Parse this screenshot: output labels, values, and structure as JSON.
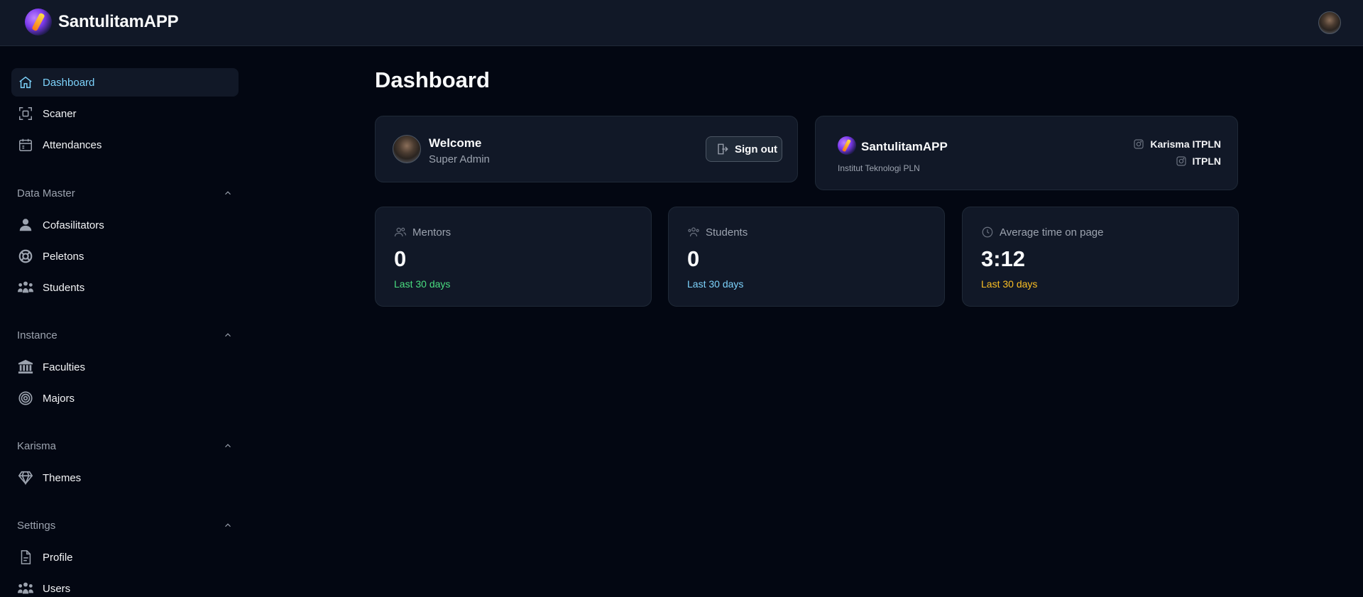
{
  "app": {
    "name": "SantulitamAPP"
  },
  "sidebar": {
    "top_items": [
      {
        "label": "Dashboard",
        "icon": "home-icon",
        "active": true
      },
      {
        "label": "Scaner",
        "icon": "scan-icon"
      },
      {
        "label": "Attendances",
        "icon": "calendar-icon"
      }
    ],
    "groups": [
      {
        "label": "Data Master",
        "items": [
          {
            "label": "Cofasilitators",
            "icon": "user-icon"
          },
          {
            "label": "Peletons",
            "icon": "life-buoy-icon"
          },
          {
            "label": "Students",
            "icon": "user-group-icon"
          }
        ]
      },
      {
        "label": "Instance",
        "items": [
          {
            "label": "Faculties",
            "icon": "building-columns-icon"
          },
          {
            "label": "Majors",
            "icon": "target-icon"
          }
        ]
      },
      {
        "label": "Karisma",
        "items": [
          {
            "label": "Themes",
            "icon": "diamond-icon"
          }
        ]
      },
      {
        "label": "Settings",
        "items": [
          {
            "label": "Profile",
            "icon": "document-icon"
          },
          {
            "label": "Users",
            "icon": "user-group-icon"
          }
        ]
      }
    ]
  },
  "main": {
    "title": "Dashboard",
    "welcome": {
      "title": "Welcome",
      "role": "Super Admin",
      "signout_label": "Sign out"
    },
    "app_card": {
      "name": "SantulitamAPP",
      "institution": "Institut Teknologi PLN",
      "socials": [
        {
          "label": "Karisma ITPLN",
          "icon": "instagram-icon"
        },
        {
          "label": "ITPLN",
          "icon": "instagram-icon"
        }
      ]
    },
    "stats": [
      {
        "label": "Mentors",
        "value": "0",
        "footer": "Last 30 days",
        "color": "#4ade80",
        "icon": "users-icon"
      },
      {
        "label": "Students",
        "value": "0",
        "footer": "Last 30 days",
        "color": "#7dd3fc",
        "icon": "users-icon"
      },
      {
        "label": "Average time on page",
        "value": "3:12",
        "footer": "Last 30 days",
        "color": "#fbbf24",
        "icon": "clock-icon"
      }
    ]
  }
}
